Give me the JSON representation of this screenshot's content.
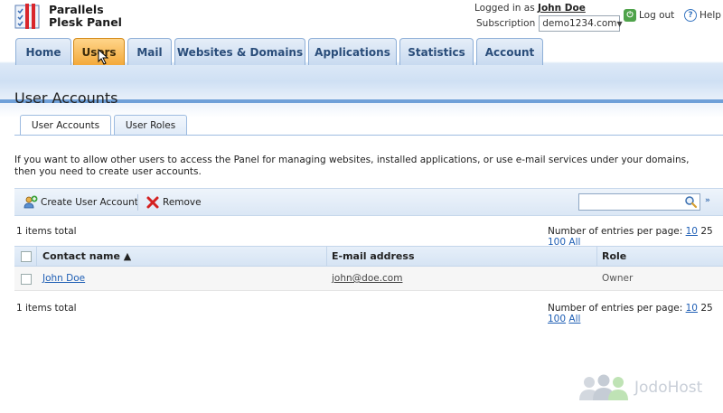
{
  "brand": {
    "line1": "Parallels",
    "line2": "Plesk Panel"
  },
  "header": {
    "logged_in_prefix": "Logged in as",
    "user_name": "John Doe",
    "subscription_label": "Subscription",
    "subscription_value": "demo1234.com",
    "logout_label": "Log out",
    "help_label": "Help"
  },
  "nav": {
    "tabs": [
      {
        "label": "Home"
      },
      {
        "label": "Users",
        "active": true
      },
      {
        "label": "Mail"
      },
      {
        "label": "Websites & Domains"
      },
      {
        "label": "Applications"
      },
      {
        "label": "Statistics"
      },
      {
        "label": "Account"
      }
    ]
  },
  "page": {
    "title": "User Accounts",
    "subtabs": [
      {
        "label": "User Accounts",
        "active": true
      },
      {
        "label": "User Roles"
      }
    ],
    "description": "If you want to allow other users to access the Panel for managing websites, installed applications, or use e-mail services under your domains, then you need to create user accounts."
  },
  "toolbar": {
    "create_label": "Create User Account",
    "remove_label": "Remove",
    "search_placeholder": "",
    "expand_glyph": "»"
  },
  "list": {
    "total_label": "1 items total",
    "per_page_label": "Number of entries per page:",
    "per_page_options": [
      "10",
      "25",
      "100",
      "All"
    ],
    "per_page_current": "25",
    "columns": {
      "contact": "Contact name ▲",
      "email": "E-mail address",
      "role": "Role"
    },
    "rows": [
      {
        "contact": "John Doe",
        "email": "john@doe.com",
        "role": "Owner"
      }
    ]
  },
  "watermark": "JodoHost",
  "colors": {
    "nav_active": "#f3a93a",
    "nav_bg": "#c8daf0",
    "link": "#1f5fb5",
    "accent_line": "#6fa0d8"
  }
}
